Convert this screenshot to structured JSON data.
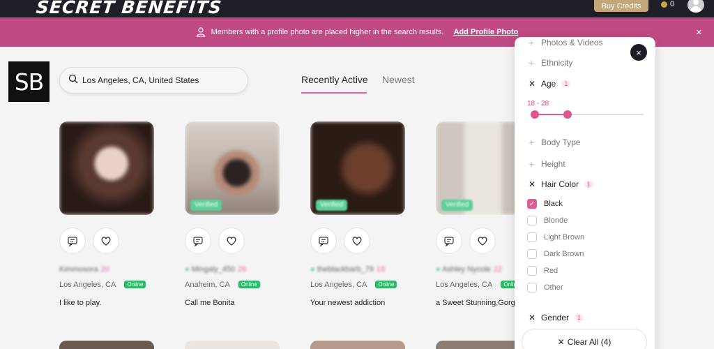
{
  "header": {
    "brand": "SECRET BENEFITS",
    "buy_credits": "Buy Credits",
    "credits": "0"
  },
  "banner": {
    "message": "Members with a profile photo are placed higher in the search results.",
    "link": "Add Profile Photo",
    "close": "×"
  },
  "logo": {
    "text": "SB"
  },
  "search": {
    "value": "Los Angeles, CA, United States"
  },
  "tabs": [
    {
      "label": "Recently Active",
      "active": true
    },
    {
      "label": "Newest",
      "active": false
    }
  ],
  "profiles": [
    {
      "username": "Kimmosora",
      "age": "20",
      "location": "Los Angeles, CA",
      "status": "Online",
      "bio": "I like to play.",
      "verified": false
    },
    {
      "username": "Mingaly_450",
      "age": "26",
      "location": "Anaheim, CA",
      "status": "Online",
      "bio": "Call me Bonita",
      "verified": true,
      "verified_label": "Verified"
    },
    {
      "username": "theblackbarb_79",
      "age": "19",
      "location": "Los Angeles, CA",
      "status": "Online",
      "bio": "Your newest addiction",
      "verified": true,
      "verified_label": "Verified"
    },
    {
      "username": "Ashley Nycole",
      "age": "22",
      "location": "Los Angeles, CA",
      "status": "Online",
      "bio": "a Sweet Stunning,Gorge",
      "verified": true,
      "verified_label": "Verified"
    }
  ],
  "filters": {
    "items": [
      {
        "label": "Photos & Videos",
        "state": "collapsed"
      },
      {
        "label": "Ethnicity",
        "state": "collapsed"
      },
      {
        "label": "Age",
        "state": "expanded",
        "count": "1"
      },
      {
        "label": "Body Type",
        "state": "collapsed"
      },
      {
        "label": "Height",
        "state": "collapsed"
      },
      {
        "label": "Hair Color",
        "state": "expanded",
        "count": "1"
      },
      {
        "label": "Gender",
        "state": "expanded",
        "count": "1"
      }
    ],
    "age_range": {
      "label": "18 - 28",
      "min": 18,
      "max": 28,
      "low_fraction": 0.04,
      "high_fraction": 0.33
    },
    "hair_colors": [
      {
        "label": "Black",
        "checked": true
      },
      {
        "label": "Blonde",
        "checked": false
      },
      {
        "label": "Light Brown",
        "checked": false
      },
      {
        "label": "Dark Brown",
        "checked": false
      },
      {
        "label": "Red",
        "checked": false
      },
      {
        "label": "Other",
        "checked": false
      }
    ],
    "clear_all": "Clear All (4)",
    "close": "×"
  },
  "colors": {
    "accent": "#e05a93",
    "banner": "#c04a83",
    "topbar": "#1f1f28",
    "online": "#2fb86a"
  }
}
